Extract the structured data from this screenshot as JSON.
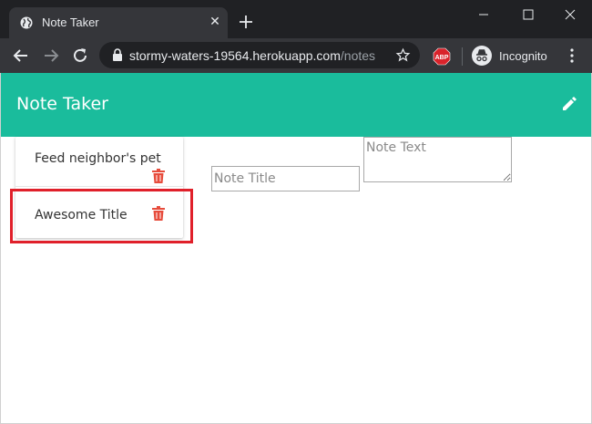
{
  "browser": {
    "tab_title": "Note Taker",
    "tab_close": "✕",
    "url_host": "stormy-waters-19564.herokuapp.com",
    "url_path": "/notes",
    "profile_label": "Incognito",
    "adblock_label": "ABP"
  },
  "app": {
    "title": "Note Taker",
    "accent_color": "#1abc9c",
    "delete_color": "#e74c3c"
  },
  "notes": [
    {
      "title": "Feed neighbor's pet"
    },
    {
      "title": "Awesome Title"
    }
  ],
  "editor": {
    "title_placeholder": "Note Title",
    "text_placeholder": "Note Text"
  }
}
